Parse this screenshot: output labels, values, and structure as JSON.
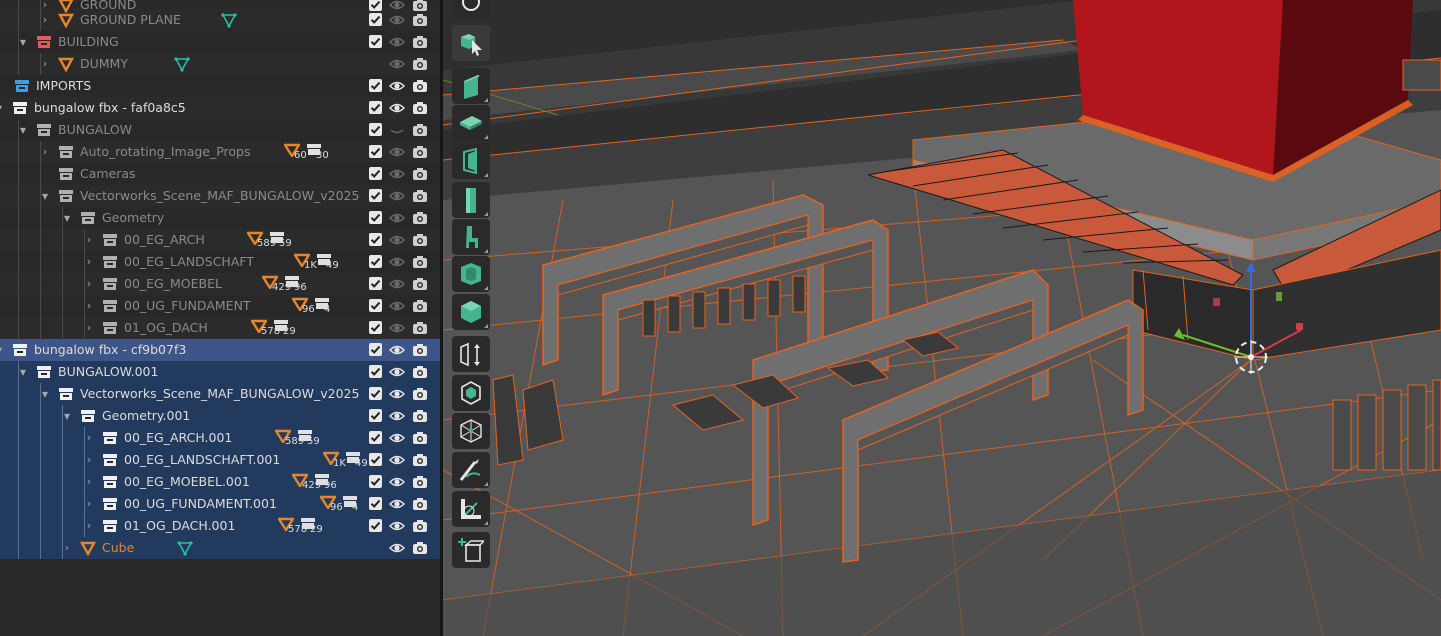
{
  "outliner": {
    "rows": [
      {
        "label": "GROUND",
        "dim": true
      },
      {
        "label": "GROUND PLANE",
        "dim": true
      },
      {
        "label": "BUILDING",
        "dim": true
      },
      {
        "label": "DUMMY",
        "dim": true
      },
      {
        "label": "IMPORTS"
      },
      {
        "label": "bungalow fbx - faf0a8c5"
      },
      {
        "label": "BUNGALOW",
        "dim": true
      },
      {
        "label": "Auto_rotating_Image_Props",
        "dim": true,
        "badge_a": "60",
        "badge_b": "30"
      },
      {
        "label": "Cameras",
        "dim": true
      },
      {
        "label": "Vectorworks_Scene_MAF_BUNGALOW_v2025",
        "dim": true
      },
      {
        "label": "Geometry",
        "dim": true
      },
      {
        "label": "00_EG_ARCH",
        "dim": true,
        "badge_a": "589",
        "badge_b": "59"
      },
      {
        "label": "00_EG_LANDSCHAFT",
        "dim": true,
        "badge_a": "1K",
        "badge_b": "49"
      },
      {
        "label": "00_EG_MOEBEL",
        "dim": true,
        "badge_a": "429",
        "badge_b": "96"
      },
      {
        "label": "00_UG_FUNDAMENT",
        "dim": true,
        "badge_a": "96",
        "badge_b": "4"
      },
      {
        "label": "01_OG_DACH",
        "dim": true,
        "badge_a": "578",
        "badge_b": "29"
      },
      {
        "label": "bungalow fbx - cf9b07f3"
      },
      {
        "label": "BUNGALOW.001"
      },
      {
        "label": "Vectorworks_Scene_MAF_BUNGALOW_v2025"
      },
      {
        "label": "Geometry.001"
      },
      {
        "label": "00_EG_ARCH.001",
        "badge_a": "589",
        "badge_b": "59"
      },
      {
        "label": "00_EG_LANDSCHAFT.001",
        "badge_a": "1K",
        "badge_b": "49"
      },
      {
        "label": "00_EG_MOEBEL.001",
        "badge_a": "429",
        "badge_b": "96"
      },
      {
        "label": "00_UG_FUNDAMENT.001",
        "badge_a": "96",
        "badge_b": "4"
      },
      {
        "label": "01_OG_DACH.001",
        "badge_a": "578",
        "badge_b": "29"
      },
      {
        "label": "Cube"
      }
    ]
  },
  "icons": {
    "collection": "collection-box-icon",
    "object": "object-triangle-icon",
    "mesh_data": "mesh-data-icon",
    "checkbox": "checkbox-icon",
    "eye": "eye-icon",
    "camera": "camera-icon"
  },
  "colors": {
    "outliner_bg": "#282828",
    "selection_bg": "#223a5e",
    "active_bg": "#3d5588",
    "object_orange": "#e6862c",
    "mesh_teal": "#23c3a8",
    "tool_green": "#44b58e",
    "viewport_bg": "#3d3d3d",
    "selection_outline": "#e8621e",
    "building_red": "#a8161c"
  },
  "toolbar": {
    "tools": [
      "select-box",
      "cube-add",
      "wall",
      "slab",
      "door",
      "column",
      "chair",
      "window-object",
      "box",
      "stretch",
      "object-snap",
      "wireframe-sphere",
      "annotate",
      "measure",
      "add-cube"
    ]
  }
}
